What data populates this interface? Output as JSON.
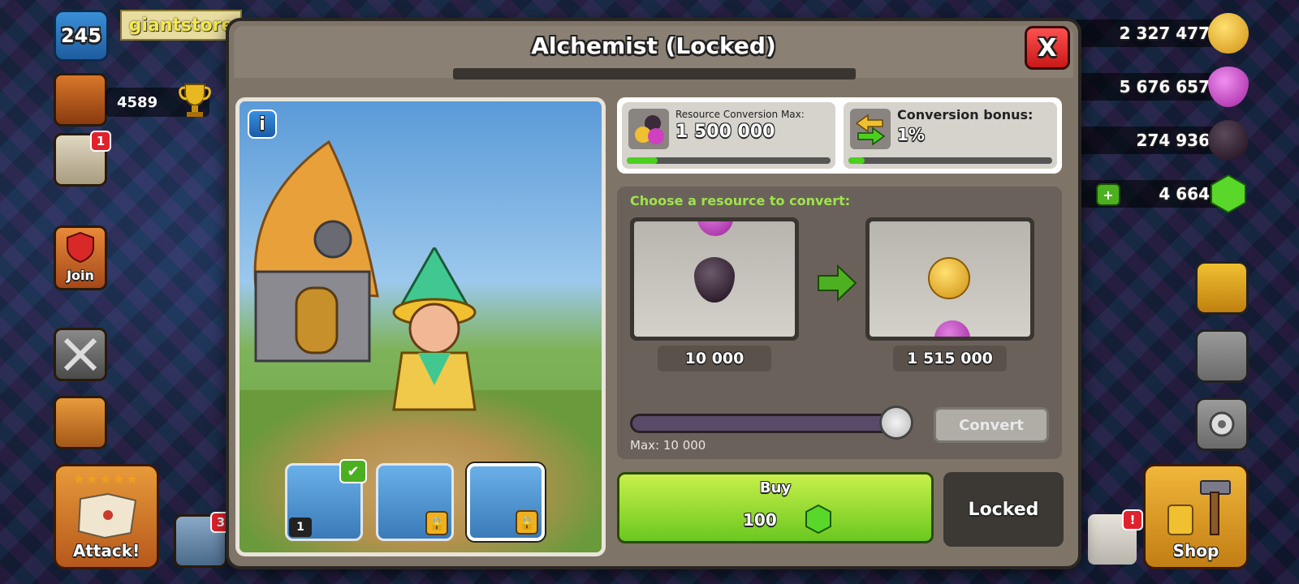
{
  "hud": {
    "level": "245",
    "store_tag": "giantstore",
    "trophies": "4589",
    "task_badge": "1",
    "clan_button": "Join",
    "attack_button": "Attack!",
    "attack_stars": "★★★★★",
    "heal_badge": "3",
    "shop_button": "Shop",
    "right_badge": "!"
  },
  "resources": [
    {
      "name": "gold",
      "value": "2 327 477",
      "color": "#f0c020"
    },
    {
      "name": "elixir",
      "value": "5 676 657",
      "color": "#d040c0"
    },
    {
      "name": "dark-elixir",
      "value": "274 936",
      "color": "#2a1a2a"
    },
    {
      "name": "gems",
      "value": "4 664",
      "color": "#4ec820"
    }
  ],
  "modal": {
    "title": "Alchemist (Locked)",
    "close_label": "X",
    "info_label": "i",
    "stats": {
      "max_label": "Resource Conversion Max:",
      "max_value": "1 500 000",
      "bonus_label": "Conversion bonus:",
      "bonus_value": "1%"
    },
    "convert": {
      "prompt": "Choose a resource to convert:",
      "from_amount": "10 000",
      "to_amount": "1 515 000",
      "max_label": "Max: 10 000",
      "button": "Convert",
      "slider_value": 1.0
    },
    "buy": {
      "label": "Buy",
      "price": "100"
    },
    "status": "Locked",
    "portraits": [
      {
        "name": "hero-1",
        "level": "1",
        "owned": true,
        "locked": false
      },
      {
        "name": "hero-2",
        "locked": true
      },
      {
        "name": "alchemist",
        "locked": true,
        "selected": true
      }
    ]
  }
}
